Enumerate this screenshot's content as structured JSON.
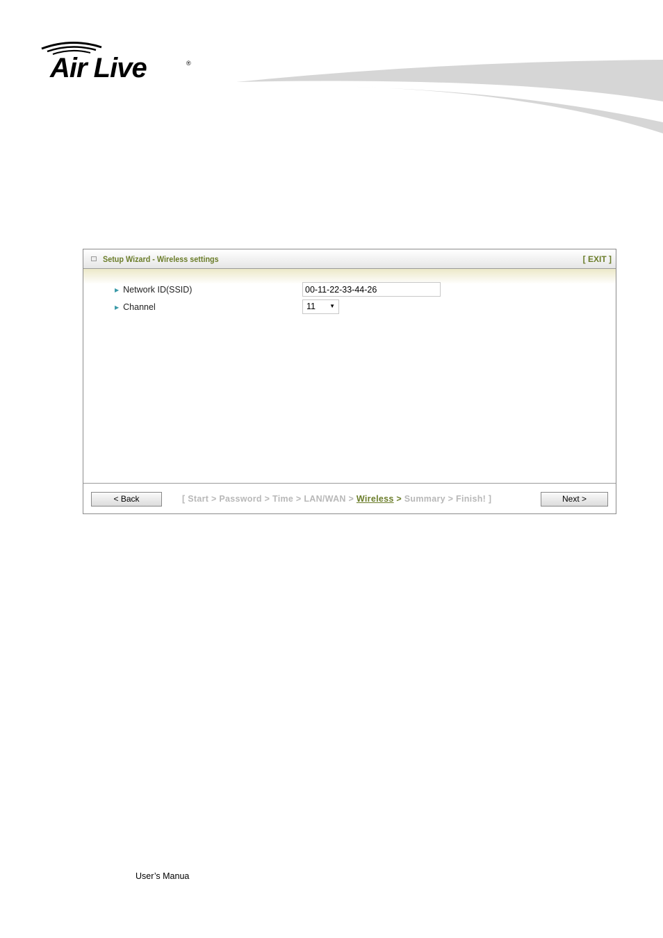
{
  "brand": {
    "logo_text": "Air Live",
    "registered": "®"
  },
  "wizard": {
    "title": "Setup Wizard - Wireless settings",
    "exit_label": "[ EXIT ]",
    "fields": [
      {
        "label": "Network ID(SSID)",
        "value": "00-11-22-33-44-26"
      },
      {
        "label": "Channel",
        "value": "11"
      }
    ],
    "back_label": "< Back",
    "next_label": "Next >",
    "steps": {
      "open": "[",
      "items": [
        "Start",
        "Password",
        "Time",
        "LAN/WAN",
        "Wireless",
        "Summary",
        "Finish!"
      ],
      "current": "Wireless",
      "close": "]",
      "separator": ">"
    }
  },
  "footer": {
    "text": "User’s Manua"
  },
  "colors": {
    "accent": "#6b7d2a",
    "inactive_step": "#b8b8b8"
  }
}
